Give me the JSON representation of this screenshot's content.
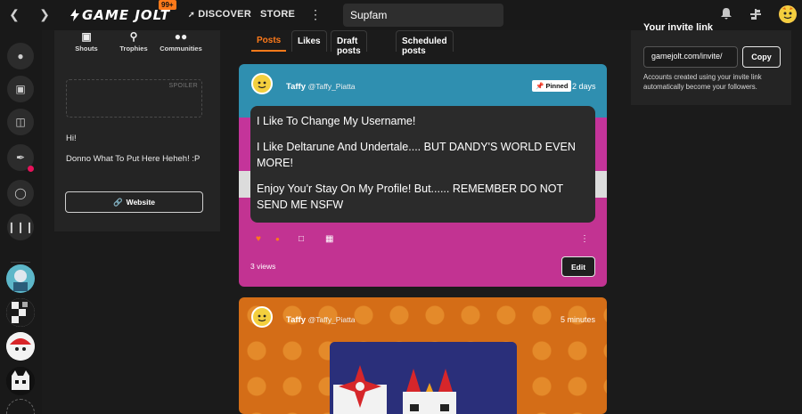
{
  "topnav": {
    "notif_count": "99+",
    "logo_text": "GAME JOLT",
    "discover_label": "DISCOVER",
    "store_label": "STORE",
    "search_value": "Supfam"
  },
  "profile": {
    "stats": [
      {
        "label": "Shouts",
        "icon": "shouts-icon"
      },
      {
        "label": "Trophies",
        "icon": "trophy-icon"
      },
      {
        "label": "Communities",
        "icon": "communities-icon"
      }
    ],
    "spoiler_label": "SPOILER",
    "bio_line1": "Hi!",
    "bio_line2": "Donno What To Put Here Heheh! :P",
    "website_label": "Website"
  },
  "tabs": [
    "Posts",
    "Likes",
    "Draft posts",
    "Scheduled posts"
  ],
  "posts": [
    {
      "name": "Taffy",
      "handle": "@Taffy_Piatta",
      "pinned_label": "Pinned",
      "time": "2 days",
      "lines": [
        "I Like To Change My Username!",
        "I Like Deltarune And Undertale.... BUT DANDY'S WORLD EVEN MORE!",
        "Enjoy You'r Stay On My Profile! But...... REMEMBER DO NOT SEND ME NSFW"
      ],
      "views": "3 views",
      "edit_label": "Edit"
    },
    {
      "name": "Taffy",
      "handle": "@Taffy_Piatta",
      "time": "5 minutes"
    }
  ],
  "invite": {
    "title": "Your invite link",
    "link": "gamejolt.com/invite/",
    "copy_label": "Copy",
    "note": "Accounts created using your invite link automatically become your followers."
  },
  "colors": {
    "accent": "#ff7a1a",
    "background": "#1b1b1b",
    "panel": "#242424"
  }
}
